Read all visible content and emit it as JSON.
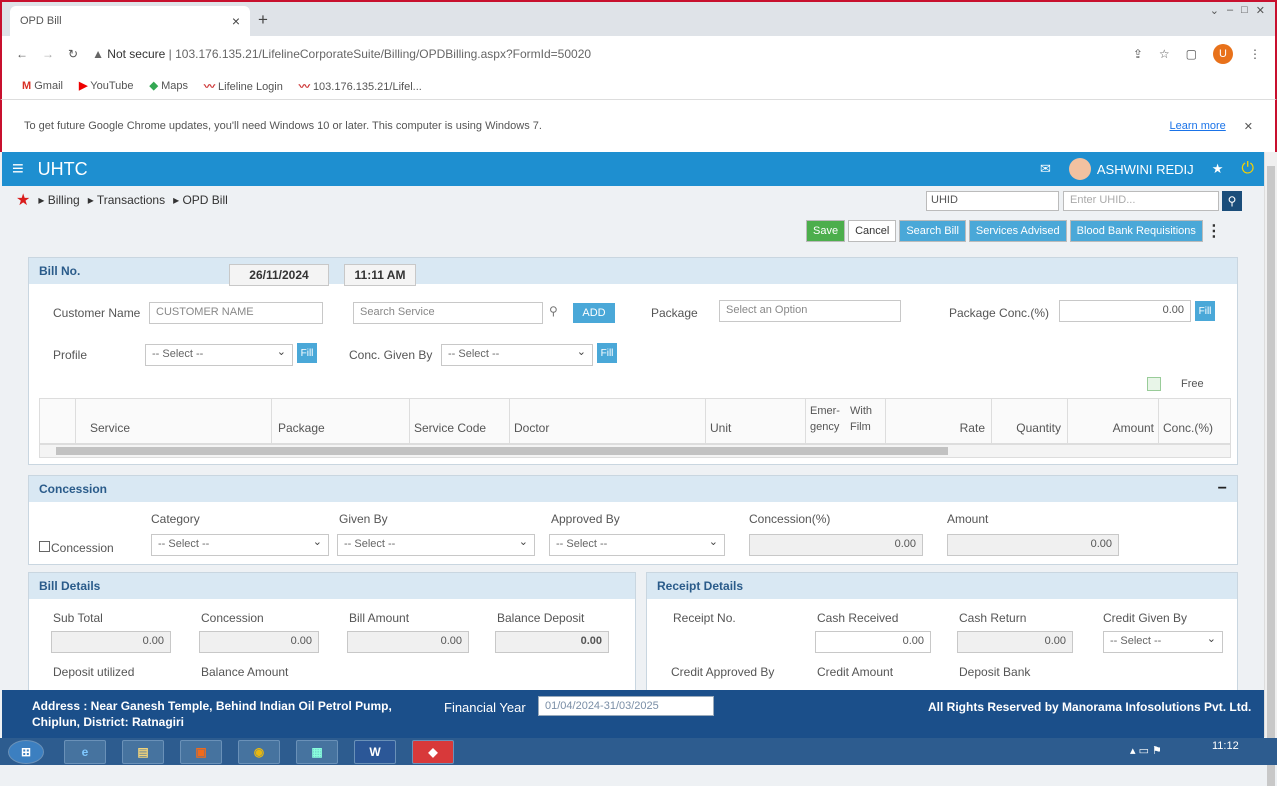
{
  "browser": {
    "tab_title": "OPD Bill",
    "tab_close": "×",
    "new_tab": "+",
    "url_prefix": "Not secure",
    "url": "103.176.135.21/LifelineCorporateSuite/Billing/OPDBilling.aspx?FormId=50020",
    "profile_initial": "U",
    "bookmarks": [
      "Gmail",
      "YouTube",
      "Maps",
      "Lifeline Login",
      "103.176.135.21/Lifel..."
    ],
    "update_message": "To get future Google Chrome updates, you'll need Windows 10 or later. This computer is using Windows 7.",
    "learn_more": "Learn more"
  },
  "app": {
    "brand": "UHTC",
    "user": "ASHWINI REDIJ"
  },
  "breadcrumb": [
    "Billing",
    "Transactions",
    "OPD Bill"
  ],
  "search": {
    "type": "UHID",
    "placeholder": "Enter UHID..."
  },
  "actions": [
    "Save",
    "Cancel",
    "Search Bill",
    "Services Advised",
    "Blood Bank Requisitions"
  ],
  "bill": {
    "header": "Bill No.",
    "date": "26/11/2024",
    "time": "11:11 AM",
    "customer_label": "Customer Name",
    "customer_placeholder": "CUSTOMER NAME",
    "service_placeholder": "Search Service",
    "add": "ADD",
    "package_label": "Package",
    "package_placeholder": "Select an Option",
    "package_conc_label": "Package Conc.(%)",
    "package_conc_value": "0.00",
    "fill": "Fill",
    "profile_label": "Profile",
    "profile_value": "-- Select --",
    "conc_given_label": "Conc. Given By",
    "conc_given_value": "-- Select --",
    "free_label": "Free",
    "columns": [
      "Service",
      "Package",
      "Service Code",
      "Doctor",
      "Unit",
      "Emer- gency",
      "With Film",
      "Rate",
      "Quantity",
      "Amount",
      "Conc.(%)"
    ]
  },
  "concession": {
    "header": "Concession",
    "checkbox_label": "Concession",
    "category_label": "Category",
    "category_value": "-- Select --",
    "given_by_label": "Given By",
    "given_by_value": "-- Select --",
    "approved_by_label": "Approved By",
    "approved_by_value": "-- Select --",
    "percent_label": "Concession(%)",
    "percent_value": "0.00",
    "amount_label": "Amount",
    "amount_value": "0.00"
  },
  "bill_details": {
    "header": "Bill Details",
    "sub_total_label": "Sub Total",
    "sub_total": "0.00",
    "concession_label": "Concession",
    "concession": "0.00",
    "bill_amount_label": "Bill Amount",
    "bill_amount": "0.00",
    "balance_deposit_label": "Balance Deposit",
    "balance_deposit": "0.00",
    "deposit_utilized_label": "Deposit utilized",
    "balance_amount_label": "Balance Amount"
  },
  "receipt": {
    "header": "Receipt Details",
    "receipt_no_label": "Receipt No.",
    "cash_received_label": "Cash Received",
    "cash_received": "0.00",
    "cash_return_label": "Cash Return",
    "cash_return": "0.00",
    "credit_given_label": "Credit Given By",
    "credit_given_value": "-- Select --",
    "credit_approved_label": "Credit Approved By",
    "credit_amount_label": "Credit Amount",
    "deposit_bank_label": "Deposit Bank"
  },
  "footer": {
    "address": "Address : Near Ganesh Temple, Behind Indian Oil Petrol Pump, Chiplun, District: Ratnagiri",
    "fy_label": "Financial Year",
    "fy_value": "01/04/2024-31/03/2025",
    "rights": "All Rights Reserved by Manorama Infosolutions Pvt. Ltd."
  },
  "taskbar": {
    "time": "11:12"
  }
}
